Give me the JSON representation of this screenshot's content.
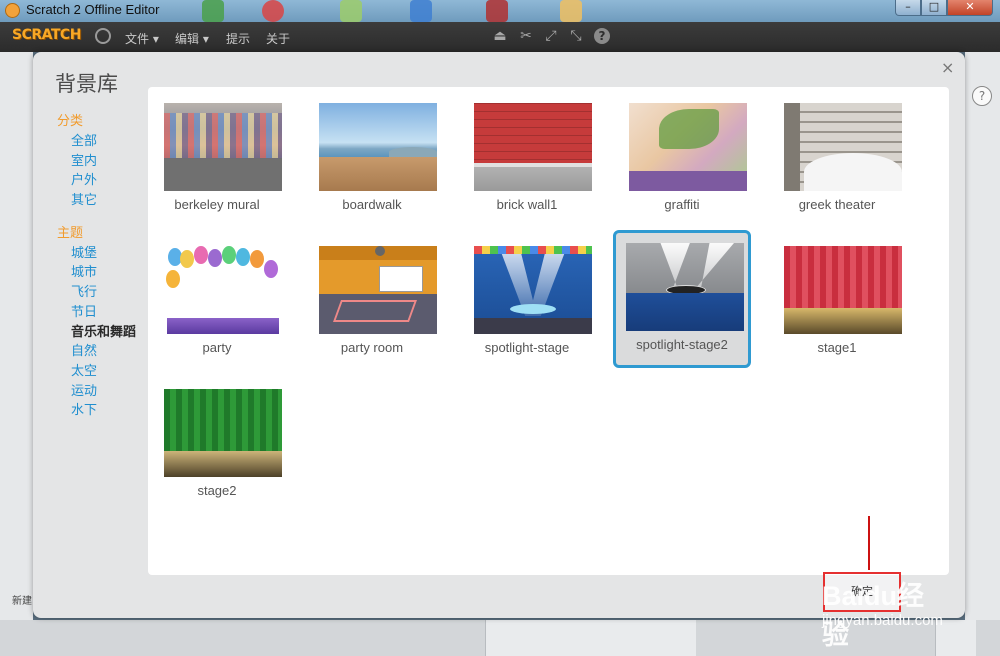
{
  "window": {
    "title": "Scratch 2 Offline Editor"
  },
  "menubar": {
    "logo": "SCRATCH",
    "menus": [
      {
        "label": "文件"
      },
      {
        "label": "编辑"
      },
      {
        "label": "提示"
      },
      {
        "label": "关于"
      }
    ]
  },
  "dialog": {
    "title": "背景库",
    "close": "×",
    "categories_heading": "分类",
    "categories": [
      {
        "label": "全部"
      },
      {
        "label": "室内"
      },
      {
        "label": "户外"
      },
      {
        "label": "其它"
      }
    ],
    "themes_heading": "主题",
    "themes": [
      {
        "label": "城堡"
      },
      {
        "label": "城市"
      },
      {
        "label": "飞行"
      },
      {
        "label": "节日"
      },
      {
        "label": "音乐和舞蹈",
        "active": true
      },
      {
        "label": "自然"
      },
      {
        "label": "太空"
      },
      {
        "label": "运动"
      },
      {
        "label": "水下"
      }
    ],
    "items": [
      {
        "label": "berkeley mural"
      },
      {
        "label": "boardwalk"
      },
      {
        "label": "brick wall1"
      },
      {
        "label": "graffiti"
      },
      {
        "label": "greek theater"
      },
      {
        "label": "party"
      },
      {
        "label": "party room"
      },
      {
        "label": "spotlight-stage"
      },
      {
        "label": "spotlight-stage2",
        "selected": true
      },
      {
        "label": "stage1"
      },
      {
        "label": "stage2"
      }
    ],
    "ok_label": "确定"
  },
  "editor_bg": {
    "new_label": "新建"
  },
  "watermark": {
    "line1": "Baidu经验",
    "line2": "jingyan.baidu.com"
  },
  "colors": {
    "accent": "#2f9ad1",
    "heading": "#f19b2d",
    "link": "#1f8ecf",
    "menubar": "#333333"
  }
}
